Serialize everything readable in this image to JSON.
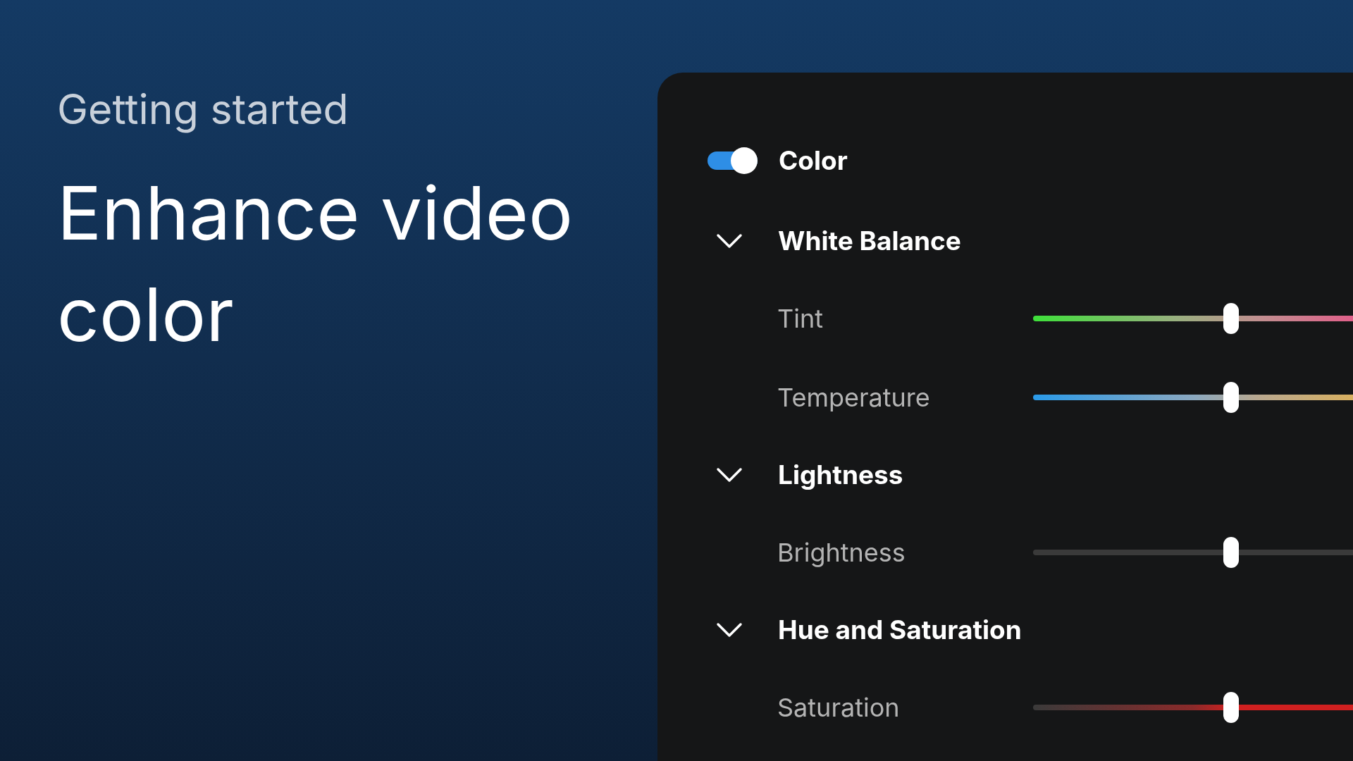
{
  "intro": {
    "eyebrow": "Getting started",
    "title": "Enhance video color"
  },
  "panel": {
    "toggle": {
      "label": "Color",
      "on": true
    },
    "sections": [
      {
        "title": "White Balance",
        "expanded": true,
        "sliders": [
          {
            "label": "Tint",
            "kind": "tint",
            "level": 0.62
          },
          {
            "label": "Temperature",
            "kind": "temperature",
            "level": 0.62
          }
        ]
      },
      {
        "title": "Lightness",
        "expanded": true,
        "sliders": [
          {
            "label": "Brightness",
            "kind": "brightness",
            "level": 0.62
          }
        ]
      },
      {
        "title": "Hue and Saturation",
        "expanded": true,
        "sliders": [
          {
            "label": "Saturation",
            "kind": "saturation",
            "level": 0.62
          }
        ]
      }
    ]
  }
}
